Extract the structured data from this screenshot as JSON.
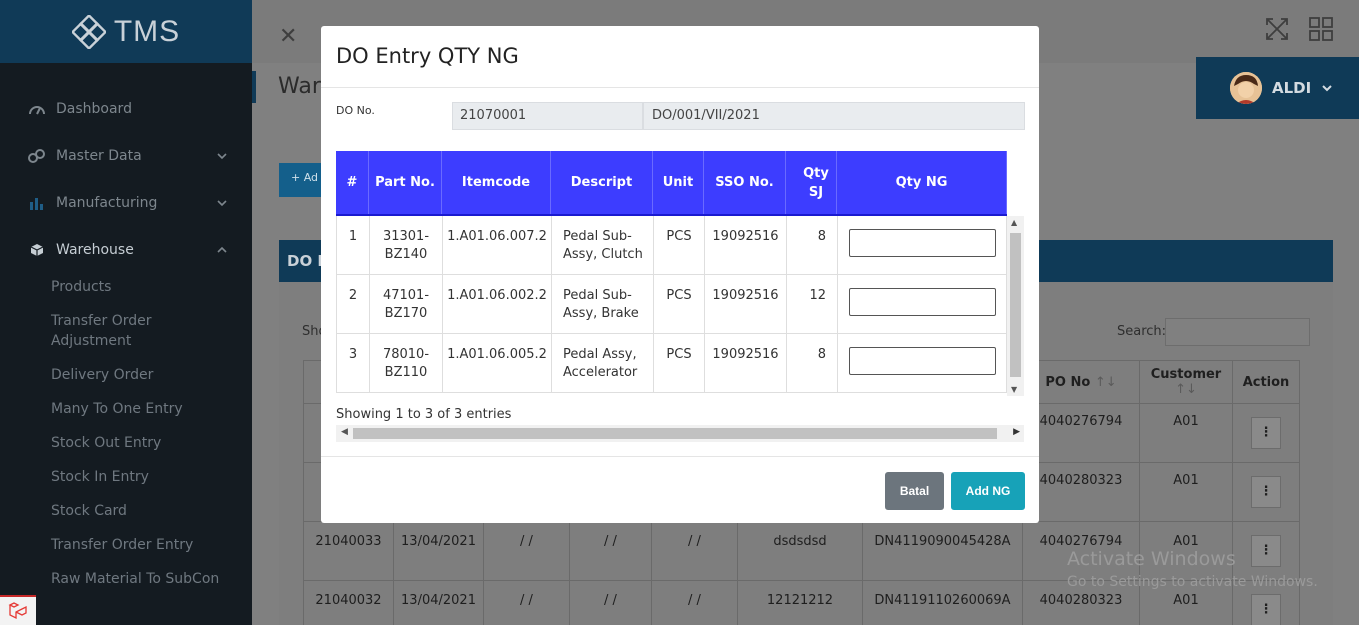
{
  "app": {
    "brand": "TMS",
    "user": "ALDI"
  },
  "sidebar": {
    "items": [
      {
        "label": "Dashboard",
        "icon": "dashboard-icon"
      },
      {
        "label": "Master Data",
        "icon": "database-icon"
      },
      {
        "label": "Manufacturing",
        "icon": "bar-chart-icon"
      },
      {
        "label": "Warehouse",
        "icon": "box-icon"
      }
    ],
    "warehouse_sub": [
      "Products",
      "Transfer Order Adjustment",
      "Delivery Order",
      "Many To One Entry",
      "Stock Out Entry",
      "Stock In Entry",
      "Stock Card",
      "Transfer Order Entry",
      "Raw Material To SubCon"
    ]
  },
  "page": {
    "title": "War",
    "add_label": "+ Ad",
    "card_title": "DO E",
    "show_label": "Sho",
    "search_label": "Search:"
  },
  "bg_table": {
    "headers": [
      "PO No",
      "Customer",
      "Action"
    ],
    "rows": [
      {
        "cells": [
          "",
          "",
          "",
          "",
          "",
          "",
          "",
          "4040276794",
          "A01"
        ]
      },
      {
        "cells": [
          "",
          "",
          "",
          "",
          "",
          "",
          "",
          "4040280323",
          "A01"
        ]
      },
      {
        "cells": [
          "21040033",
          "13/04/2021",
          "/ /",
          "/ /",
          "/ /",
          "dsdsdsd",
          "DN4119090045428A",
          "4040276794",
          "A01"
        ]
      },
      {
        "cells": [
          "21040032",
          "13/04/2021",
          "/ /",
          "/ /",
          "/ /",
          "12121212",
          "DN4119110260069A",
          "4040280323",
          "A01"
        ]
      }
    ]
  },
  "watermark": {
    "line1": "Activate Windows",
    "line2": "Go to Settings to activate Windows."
  },
  "modal": {
    "title": "DO Entry QTY NG",
    "do_label": "DO No.",
    "do_no": "21070001",
    "do_code": "DO/001/VII/2021",
    "columns": [
      "#",
      "Part No.",
      "Itemcode",
      "Descript",
      "Unit",
      "SSO No.",
      "Qty SJ",
      "Qty NG"
    ],
    "rows": [
      {
        "num": "1",
        "part": "31301-BZ140",
        "itemcode": "1.A01.06.007.2",
        "descript": "Pedal Sub-Assy, Clutch",
        "unit": "PCS",
        "sso": "19092516",
        "qty_sj": "8",
        "qty_ng": ""
      },
      {
        "num": "2",
        "part": "47101-BZ170",
        "itemcode": "1.A01.06.002.2",
        "descript": "Pedal Sub-Assy, Brake",
        "unit": "PCS",
        "sso": "19092516",
        "qty_sj": "12",
        "qty_ng": ""
      },
      {
        "num": "3",
        "part": "78010-BZ110",
        "itemcode": "1.A01.06.005.2",
        "descript": "Pedal Assy, Accelerator",
        "unit": "PCS",
        "sso": "19092516",
        "qty_sj": "8",
        "qty_ng": ""
      }
    ],
    "showing": "Showing 1 to 3 of 3 entries",
    "btn_cancel": "Batal",
    "btn_add": "Add NG"
  },
  "colors": {
    "header_blue": "#3d3dff",
    "brand_dark": "#103a57",
    "btn_info": "#17a2b8",
    "btn_secondary": "#6c757d"
  }
}
